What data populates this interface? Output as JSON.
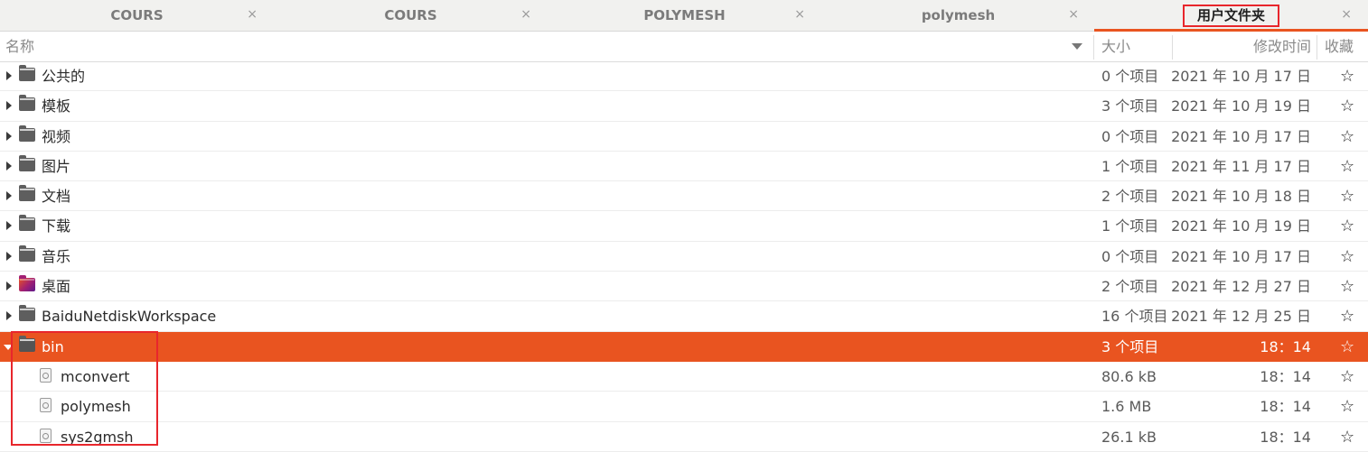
{
  "tabs": [
    {
      "label": "COURS",
      "active": false
    },
    {
      "label": "COURS",
      "active": false
    },
    {
      "label": "POLYMESH",
      "active": false
    },
    {
      "label": "polymesh",
      "active": false
    },
    {
      "label": "用户文件夹",
      "active": true
    }
  ],
  "close_glyph": "×",
  "columns": {
    "name": "名称",
    "size": "大小",
    "modified": "修改时间",
    "favorite": "收藏"
  },
  "rows": [
    {
      "name": "公共的",
      "type": "folder",
      "size": "0 个项目",
      "modified": "2021 年 10 月 17 日",
      "star": "☆"
    },
    {
      "name": "模板",
      "type": "folder",
      "size": "3 个项目",
      "modified": "2021 年 10 月 19 日",
      "star": "☆"
    },
    {
      "name": "视频",
      "type": "folder",
      "size": "0 个项目",
      "modified": "2021 年 10 月 17 日",
      "star": "☆"
    },
    {
      "name": "图片",
      "type": "folder",
      "size": "1 个项目",
      "modified": "2021 年 11 月 17 日",
      "star": "☆"
    },
    {
      "name": "文档",
      "type": "folder",
      "size": "2 个项目",
      "modified": "2021 年 10 月 18 日",
      "star": "☆"
    },
    {
      "name": "下载",
      "type": "folder",
      "size": "1 个项目",
      "modified": "2021 年 10 月 19 日",
      "star": "☆"
    },
    {
      "name": "音乐",
      "type": "folder",
      "size": "0 个项目",
      "modified": "2021 年 10 月 17 日",
      "star": "☆"
    },
    {
      "name": "桌面",
      "type": "folder-desktop",
      "size": "2 个项目",
      "modified": "2021 年 12 月 27 日",
      "star": "☆"
    },
    {
      "name": "BaiduNetdiskWorkspace",
      "type": "folder",
      "size": "16 个项目",
      "modified": "2021 年 12 月 25 日",
      "star": "☆"
    },
    {
      "name": "bin",
      "type": "folder-open",
      "size": "3 个项目",
      "modified": "18：14",
      "star": "☆",
      "selected": true
    },
    {
      "name": "mconvert",
      "type": "file",
      "size": "80.6 kB",
      "modified": "18：14",
      "star": "☆"
    },
    {
      "name": "polymesh",
      "type": "file",
      "size": "1.6 MB",
      "modified": "18：14",
      "star": "☆"
    },
    {
      "name": "sys2gmsh",
      "type": "file",
      "size": "26.1 kB",
      "modified": "18：14",
      "star": "☆"
    }
  ],
  "colors": {
    "selection": "#e95420",
    "annotation": "#e8262c"
  },
  "icons": {
    "folder": "folder-icon",
    "desktop_folder": "desktop-folder-icon",
    "file": "executable-file-icon",
    "star": "star-outline-icon",
    "close": "close-icon",
    "sort": "sort-descending-icon"
  }
}
